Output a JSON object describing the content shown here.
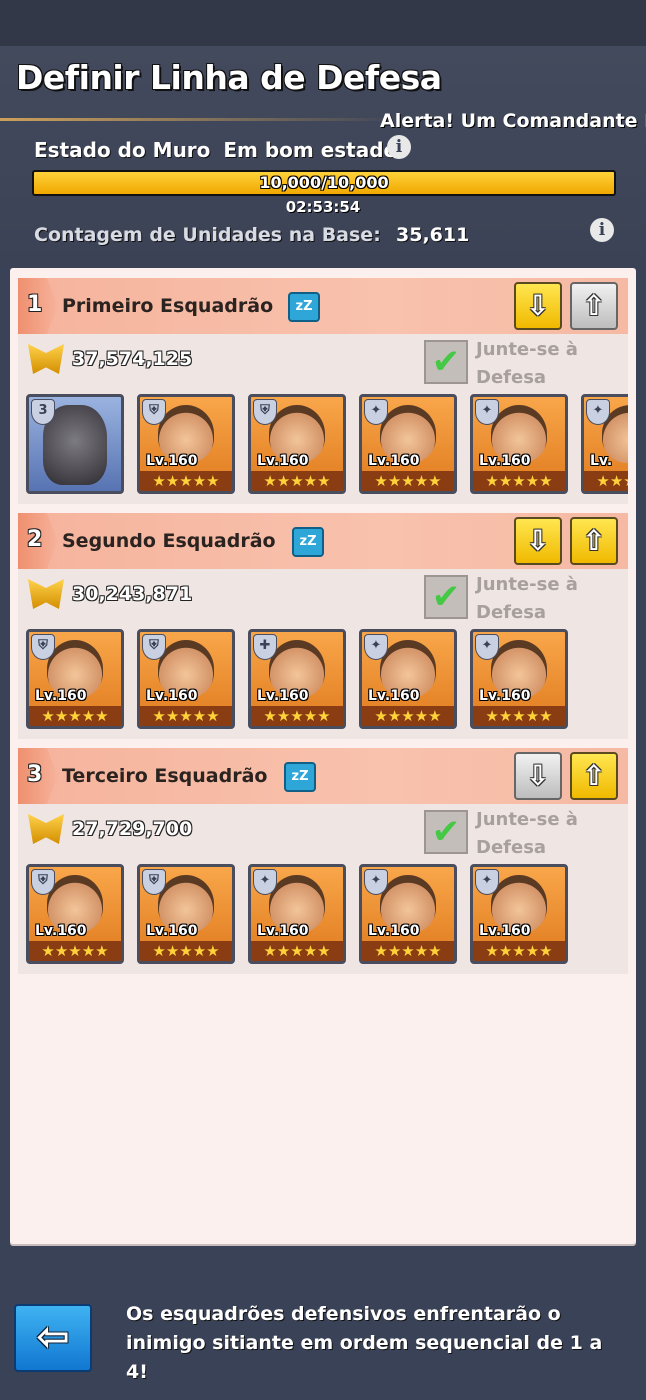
{
  "header": {
    "title": "Definir Linha de Defesa",
    "alert_ticker": "Alerta! Um Comandante P"
  },
  "wall": {
    "label": "Estado do Muro",
    "status": "Em bom estado",
    "progress_text": "10,000/10,000",
    "progress_fraction": 1.0,
    "timer": "02:53:54"
  },
  "base": {
    "units_label": "Contagem de Unidades na Base:",
    "units_value": "35,611"
  },
  "join_label": "Junte-se à Defesa",
  "squads": [
    {
      "number": "1",
      "name": "Primeiro Esquadrão",
      "power": "37,574,125",
      "down_active": true,
      "up_active": false,
      "heroes": [
        {
          "badge": "3",
          "level": "",
          "type": "gorilla"
        },
        {
          "badge": "shield",
          "level": "Lv.160"
        },
        {
          "badge": "shield",
          "level": "Lv.160"
        },
        {
          "badge": "star",
          "level": "Lv.160"
        },
        {
          "badge": "star",
          "level": "Lv.160"
        },
        {
          "badge": "star",
          "level": "Lv."
        }
      ]
    },
    {
      "number": "2",
      "name": "Segundo Esquadrão",
      "power": "30,243,871",
      "down_active": true,
      "up_active": true,
      "heroes": [
        {
          "badge": "shield",
          "level": "Lv.160"
        },
        {
          "badge": "shield",
          "level": "Lv.160"
        },
        {
          "badge": "plus",
          "level": "Lv.160"
        },
        {
          "badge": "star",
          "level": "Lv.160"
        },
        {
          "badge": "star",
          "level": "Lv.160"
        }
      ]
    },
    {
      "number": "3",
      "name": "Terceiro Esquadrão",
      "power": "27,729,700",
      "down_active": false,
      "up_active": true,
      "heroes": [
        {
          "badge": "shield",
          "level": "Lv.160"
        },
        {
          "badge": "shield",
          "level": "Lv.160"
        },
        {
          "badge": "star",
          "level": "Lv.160"
        },
        {
          "badge": "star",
          "level": "Lv.160"
        },
        {
          "badge": "star",
          "level": "Lv.160"
        }
      ]
    }
  ],
  "stars": "★★★★★",
  "footer": {
    "back_icon": "arrow-left-icon",
    "text": "Os esquadrões defensivos enfrentarão o inimigo sitiante em ordem sequencial de 1 a 4!"
  },
  "colors": {
    "accent_yellow": "#f0b900",
    "squad_header": "#f6b39c",
    "back_button": "#1177d1"
  }
}
